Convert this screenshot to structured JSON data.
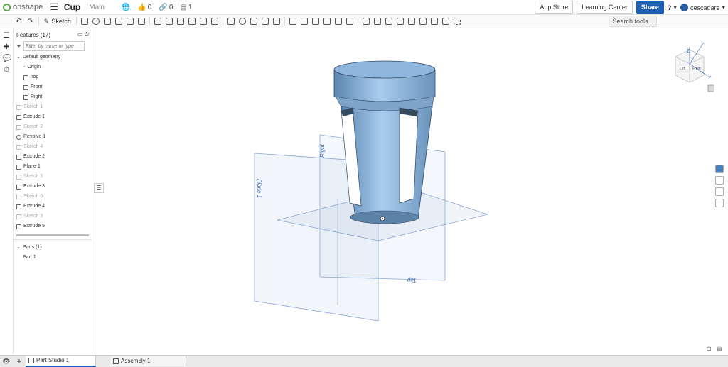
{
  "header": {
    "logo_text": "onshape",
    "doc_title": "Cup",
    "branch": "Main",
    "likes": "0",
    "links": "0",
    "versions": "1",
    "app_store": "App Store",
    "learning_center": "Learning Center",
    "share": "Share",
    "help": "?",
    "user": "cescadare"
  },
  "toolbar": {
    "sketch_label": "Sketch",
    "search_tools": "Search tools..."
  },
  "features": {
    "header": "Features (17)",
    "filter_placeholder": "Filter by name or type",
    "default_geometry": "Default geometry",
    "geometry_items": [
      "Origin",
      "Top",
      "Front",
      "Right"
    ],
    "items": [
      {
        "label": "Sketch 1",
        "dim": true
      },
      {
        "label": "Extrude 1",
        "dim": false
      },
      {
        "label": "Sketch 2",
        "dim": true
      },
      {
        "label": "Revolve 1",
        "dim": false
      },
      {
        "label": "Sketch 4",
        "dim": true
      },
      {
        "label": "Extrude 2",
        "dim": false
      },
      {
        "label": "Plane 1",
        "dim": false
      },
      {
        "label": "Sketch 5",
        "dim": true
      },
      {
        "label": "Extrude 3",
        "dim": false
      },
      {
        "label": "Sketch 6",
        "dim": true
      },
      {
        "label": "Extrude 4",
        "dim": false
      },
      {
        "label": "Sketch 3",
        "dim": true
      },
      {
        "label": "Extrude 5",
        "dim": false
      }
    ]
  },
  "parts": {
    "header": "Parts (1)",
    "items": [
      "Part 1"
    ]
  },
  "viewport": {
    "plane_labels": [
      "Plane 1",
      "Right",
      "Top"
    ],
    "cube_labels": [
      "Z",
      "Y",
      "Left",
      "Front"
    ]
  },
  "tabs": [
    {
      "label": "Part Studio 1",
      "active": true
    },
    {
      "label": "Assembly 1",
      "active": false
    }
  ],
  "colors": {
    "accent": "#1c5fb5",
    "part": "#9fc3e6",
    "plane": "#b8cbe6"
  }
}
